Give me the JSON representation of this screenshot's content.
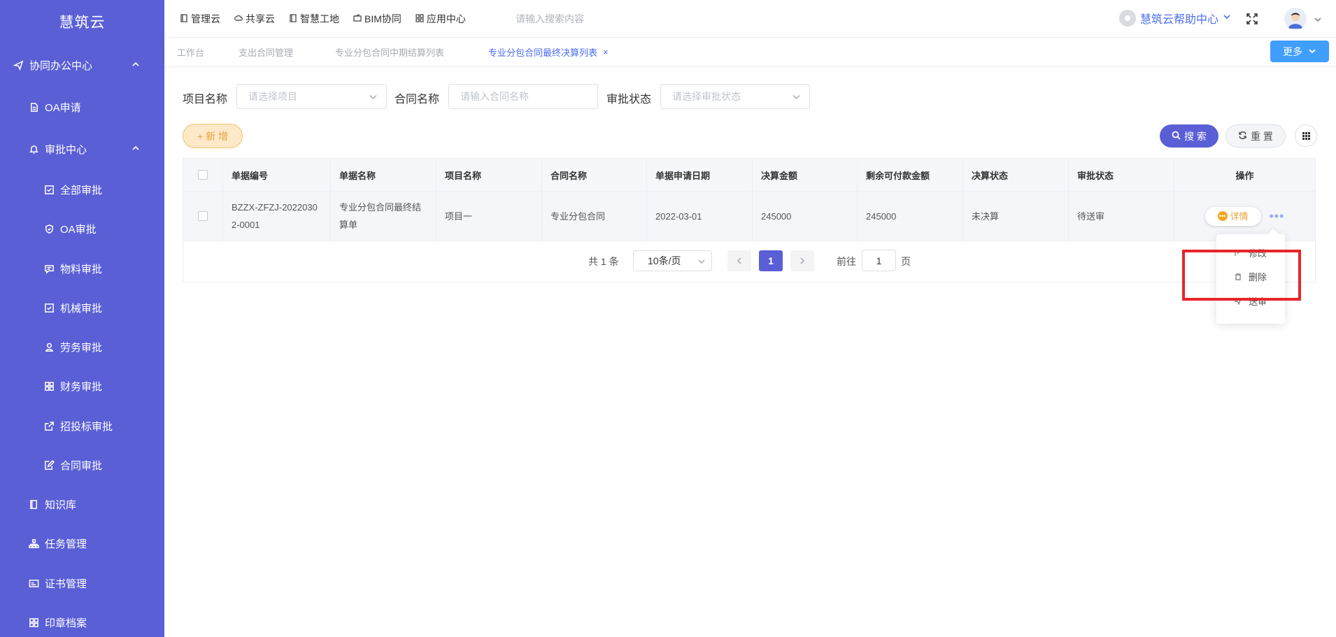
{
  "sidebar": {
    "logo": "慧筑云",
    "items": [
      {
        "label": "协同办公中心"
      },
      {
        "label": "OA申请"
      },
      {
        "label": "审批中心"
      },
      {
        "label": "全部审批"
      },
      {
        "label": "OA审批"
      },
      {
        "label": "物料审批"
      },
      {
        "label": "机械审批"
      },
      {
        "label": "劳务审批"
      },
      {
        "label": "财务审批"
      },
      {
        "label": "招投标审批"
      },
      {
        "label": "合同审批"
      },
      {
        "label": "知识库"
      },
      {
        "label": "任务管理"
      },
      {
        "label": "证书管理"
      },
      {
        "label": "印章档案"
      }
    ]
  },
  "topnav": {
    "items": [
      {
        "label": "管理云"
      },
      {
        "label": "共享云"
      },
      {
        "label": "智慧工地"
      },
      {
        "label": "BIM协同"
      },
      {
        "label": "应用中心"
      }
    ],
    "search_placeholder": "请输入搜索内容",
    "help_label": "慧筑云帮助中心"
  },
  "tabs": {
    "items": [
      {
        "label": "工作台"
      },
      {
        "label": "支出合同管理"
      },
      {
        "label": "专业分包合同中期结算列表"
      },
      {
        "label": "专业分包合同最终决算列表"
      }
    ],
    "close_symbol": "×",
    "more_label": "更多"
  },
  "filters": {
    "project_label": "项目名称",
    "project_placeholder": "请选择项目",
    "contract_label": "合同名称",
    "contract_placeholder": "请输入合同名称",
    "status_label": "审批状态",
    "status_placeholder": "请选择审批状态"
  },
  "actions": {
    "add_label": "新 增",
    "add_symbol": "+",
    "search_label": "搜 索",
    "reset_label": "重 置"
  },
  "table": {
    "columns": [
      "单据编号",
      "单据名称",
      "项目名称",
      "合同名称",
      "单据申请日期",
      "决算金额",
      "剩余可付款金额",
      "决算状态",
      "审批状态",
      "操作"
    ],
    "rows": [
      {
        "code": "BZZX-ZFZJ-20220302-0001",
        "name": "专业分包合同最终结算单",
        "project": "项目一",
        "contract": "专业分包合同",
        "date": "2022-03-01",
        "amount": "245000",
        "remaining": "245000",
        "settle_status": "未决算",
        "approve_status": "待送审",
        "detail_label": "详情",
        "more_symbol": "•••"
      }
    ]
  },
  "pagination": {
    "total": "共 1 条",
    "page_size": "10条/页",
    "current": "1",
    "goto_prefix": "前往",
    "goto_value": "1",
    "goto_suffix": "页"
  },
  "dropdown_menu": {
    "items": [
      {
        "label": "修改"
      },
      {
        "label": "删除"
      },
      {
        "label": "送审"
      }
    ]
  },
  "colors": {
    "sidebar": "#5a5fd6",
    "accent": "#4d6cf0",
    "more_button": "#409eff",
    "add_button": "#e6a23c",
    "highlight_box": "#e8252a"
  }
}
